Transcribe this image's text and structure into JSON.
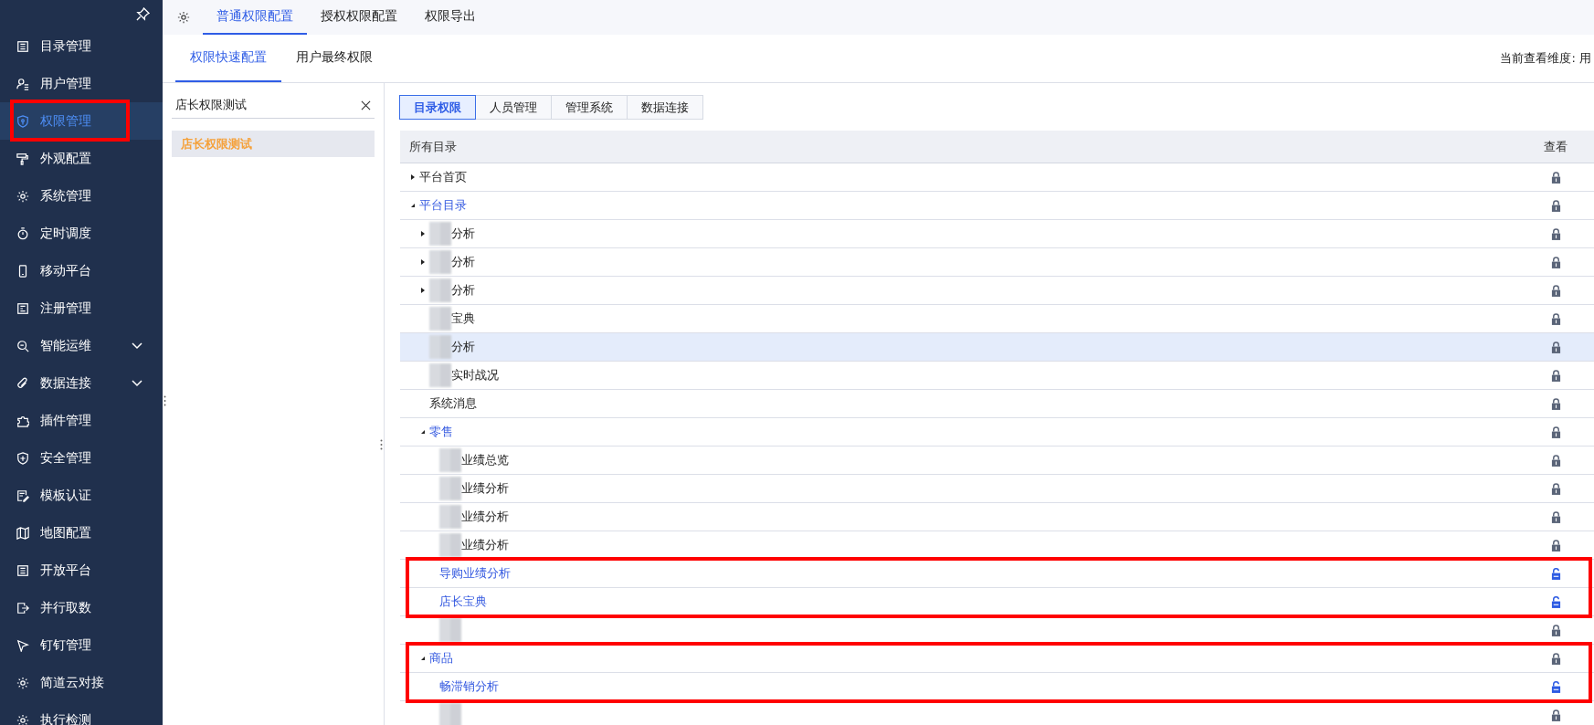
{
  "sidebar": {
    "items": [
      {
        "label": "目录管理",
        "selected": false,
        "outlined": false
      },
      {
        "label": "用户管理",
        "selected": false,
        "outlined": false
      },
      {
        "label": "权限管理",
        "selected": true,
        "outlined": true
      },
      {
        "label": "外观配置",
        "selected": false,
        "outlined": false
      },
      {
        "label": "系统管理",
        "selected": false,
        "outlined": false
      },
      {
        "label": "定时调度",
        "selected": false,
        "outlined": false
      },
      {
        "label": "移动平台",
        "selected": false,
        "outlined": false
      },
      {
        "label": "注册管理",
        "selected": false,
        "outlined": false
      },
      {
        "label": "智能运维",
        "selected": false,
        "outlined": false,
        "expanded": false
      },
      {
        "label": "数据连接",
        "selected": false,
        "outlined": false,
        "expanded": false
      },
      {
        "label": "插件管理",
        "selected": false,
        "outlined": false
      },
      {
        "label": "安全管理",
        "selected": false,
        "outlined": false
      },
      {
        "label": "模板认证",
        "selected": false,
        "outlined": false
      },
      {
        "label": "地图配置",
        "selected": false,
        "outlined": false
      },
      {
        "label": "开放平台",
        "selected": false,
        "outlined": false
      },
      {
        "label": "并行取数",
        "selected": false,
        "outlined": false
      },
      {
        "label": "钉钉管理",
        "selected": false,
        "outlined": false
      },
      {
        "label": "简道云对接",
        "selected": false,
        "outlined": false
      },
      {
        "label": "执行检测",
        "selected": false,
        "outlined": false
      }
    ]
  },
  "top_tabs": [
    {
      "label": "普通权限配置",
      "selected": true
    },
    {
      "label": "授权权限配置",
      "selected": false
    },
    {
      "label": "权限导出",
      "selected": false
    }
  ],
  "sub_tabs": [
    {
      "label": "权限快速配置",
      "selected": true
    },
    {
      "label": "用户最终权限",
      "selected": false
    }
  ],
  "view_dimension": "当前查看维度: 用",
  "role_panel": {
    "search": {
      "value": "店长权限测试"
    },
    "roles": [
      {
        "label": "店长权限测试",
        "selected": true
      }
    ]
  },
  "category_tabs": [
    {
      "label": "目录权限",
      "selected": true
    },
    {
      "label": "人员管理",
      "selected": false
    },
    {
      "label": "管理系统",
      "selected": false
    },
    {
      "label": "数据连接",
      "selected": false
    }
  ],
  "table": {
    "columns": [
      "所有目录",
      "查看"
    ],
    "rows": [
      {
        "name": "平台首页",
        "expanded": false,
        "selected": false,
        "locked": true,
        "redacted": false,
        "outlined": false
      },
      {
        "name": "平台目录",
        "expanded": true,
        "selected": false,
        "locked": true,
        "redacted": false,
        "outlined": false,
        "children": [
          {
            "name": "分析",
            "expanded": false,
            "selected": false,
            "locked": true,
            "redacted": true,
            "outlined": false
          },
          {
            "name": "分析",
            "expanded": false,
            "selected": false,
            "locked": true,
            "redacted": true,
            "outlined": false
          },
          {
            "name": "分析",
            "expanded": false,
            "selected": false,
            "locked": true,
            "redacted": true,
            "outlined": false
          },
          {
            "name": "宝典",
            "selected": false,
            "locked": true,
            "redacted": true,
            "outlined": false
          },
          {
            "name": "分析",
            "selected": true,
            "locked": true,
            "redacted": true,
            "outlined": false
          },
          {
            "name": "实时战况",
            "selected": false,
            "locked": true,
            "redacted": true,
            "outlined": false
          },
          {
            "name": "系统消息",
            "selected": false,
            "locked": true,
            "redacted": false,
            "outlined": false
          },
          {
            "name": "零售",
            "expanded": true,
            "selected": false,
            "locked": true,
            "redacted": false,
            "outlined": false,
            "children": [
              {
                "name": "业绩总览",
                "selected": false,
                "locked": true,
                "redacted": true,
                "outlined": false
              },
              {
                "name": "业绩分析",
                "selected": false,
                "locked": true,
                "redacted": true,
                "outlined": false
              },
              {
                "name": "业绩分析",
                "selected": false,
                "locked": true,
                "redacted": true,
                "outlined": false
              },
              {
                "name": "业绩分析",
                "selected": false,
                "locked": true,
                "redacted": true,
                "outlined": false
              },
              {
                "name": "导购业绩分析",
                "selected": false,
                "locked": false,
                "redacted": false,
                "outlined": true
              },
              {
                "name": "店长宝典",
                "selected": false,
                "locked": false,
                "redacted": false,
                "outlined": true
              },
              {
                "selected": false,
                "locked": true,
                "redacted": true,
                "outlined": false
              }
            ]
          },
          {
            "name": "商品",
            "expanded": true,
            "selected": false,
            "locked": true,
            "redacted": false,
            "outlined": true,
            "children": [
              {
                "name": "畅滞销分析",
                "selected": false,
                "locked": false,
                "redacted": false,
                "outlined": true
              },
              {
                "selected": false,
                "locked": true,
                "redacted": true,
                "outlined": false
              }
            ]
          }
        ]
      }
    ]
  }
}
